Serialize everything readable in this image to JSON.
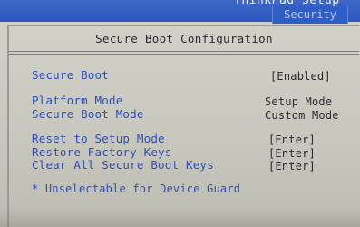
{
  "header": {
    "app_title": "ThinkPad Setup",
    "active_tab": "Security"
  },
  "page": {
    "title": "Secure Boot Configuration"
  },
  "settings": [
    {
      "label": "Secure Boot",
      "value": "[Enabled]"
    },
    {
      "label": "Platform Mode",
      "value": "Setup Mode"
    },
    {
      "label": "Secure Boot Mode",
      "value": "Custom Mode"
    },
    {
      "label": "Reset to Setup Mode",
      "value": "[Enter]"
    },
    {
      "label": "Restore Factory Keys",
      "value": "[Enter]"
    },
    {
      "label": "Clear All Secure Boot Keys",
      "value": "[Enter]"
    }
  ],
  "footnote": "* Unselectable for Device Guard"
}
